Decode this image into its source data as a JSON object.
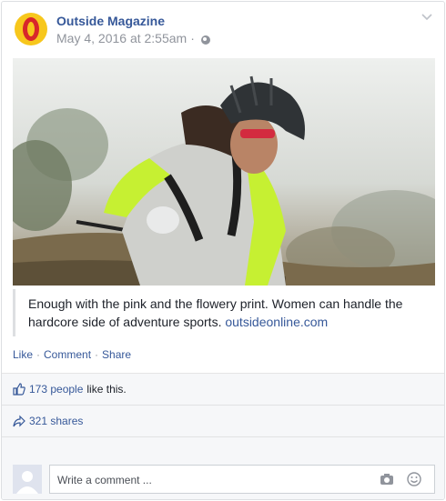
{
  "post": {
    "page_name": "Outside Magazine",
    "timestamp": "May 4, 2016 at 2:55am",
    "privacy_separator": "·",
    "caption_text": "Enough with the pink and the flowery print. Women can handle the hardcore side of adventure sports.",
    "caption_link": "outsideonline.com",
    "photo_description": "mountain-biker-woman-helmet-foggy-trail"
  },
  "actions": {
    "like": "Like",
    "comment": "Comment",
    "share": "Share",
    "separator": "·"
  },
  "ufi": {
    "likes_link": "173 people",
    "likes_suffix": "like this.",
    "shares_link": "321 shares",
    "comment_placeholder": "Write a comment ..."
  },
  "colors": {
    "link": "#365899",
    "secondary": "#90949c",
    "footer_bg": "#f6f7f9",
    "logo_yellow": "#f7c71c",
    "logo_red": "#d8262b",
    "jersey_neon": "#c6f032"
  }
}
